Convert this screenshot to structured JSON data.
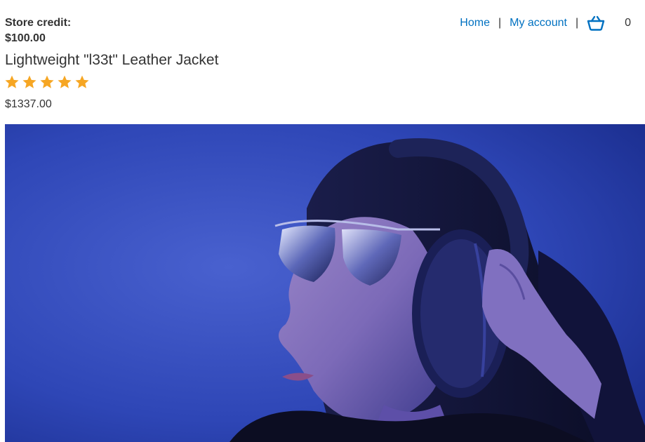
{
  "header": {
    "store_credit_label": "Store credit:",
    "store_credit_value": "$100.00",
    "nav": {
      "home": "Home",
      "separator": "|",
      "my_account": "My account",
      "cart_count": "0"
    }
  },
  "product": {
    "title": "Lightweight \"l33t\" Leather Jacket",
    "rating_stars": 5,
    "rating_max": 5,
    "price": "$1337.00",
    "image_icon": "product-photo-woman-headphones"
  },
  "colors": {
    "link": "#0071c1",
    "star": "#f6a623",
    "text": "#333333"
  }
}
